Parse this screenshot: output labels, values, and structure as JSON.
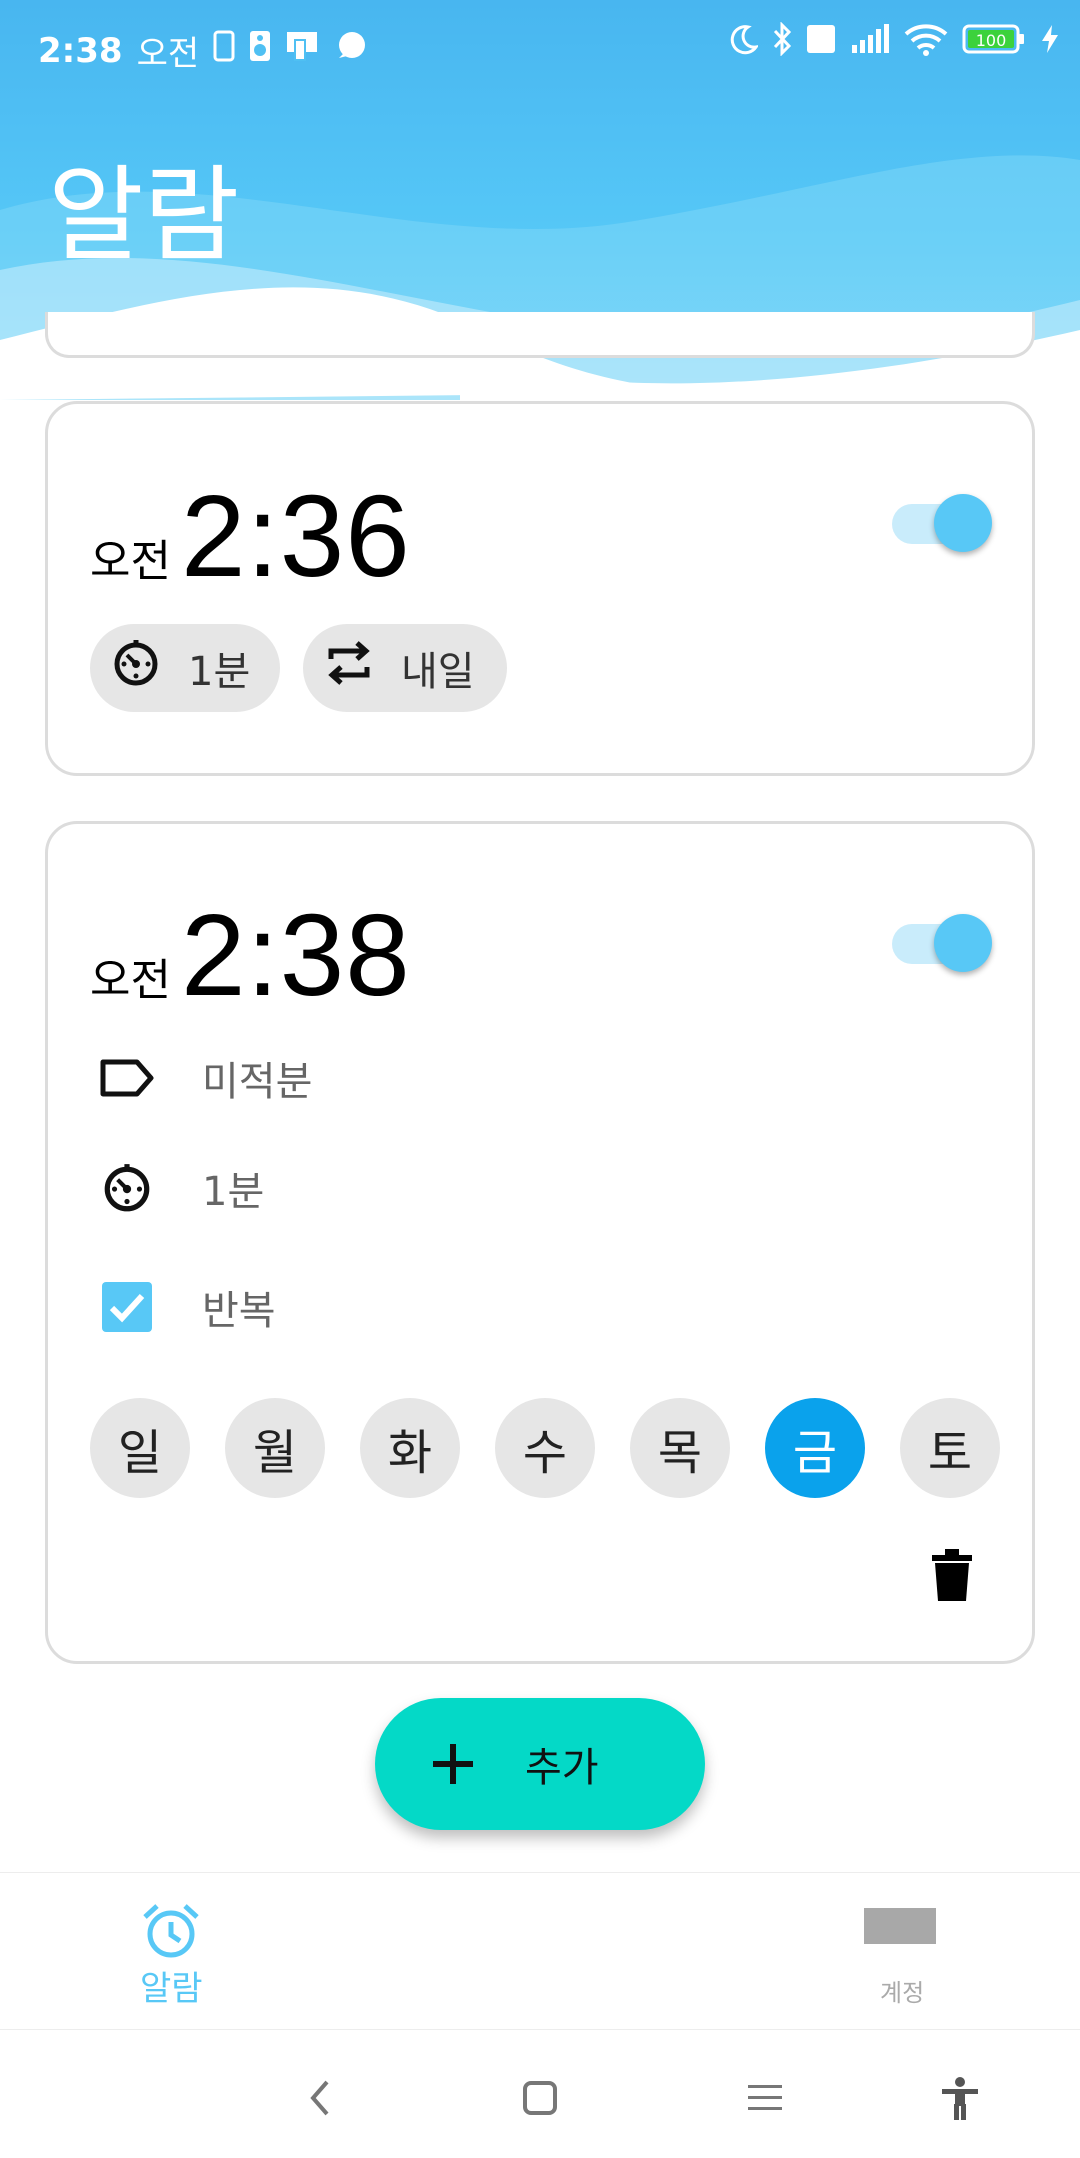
{
  "status_bar": {
    "time": "2:38",
    "ampm": "오전",
    "battery": "100"
  },
  "header": {
    "title": "알람"
  },
  "alarms": [
    {
      "ampm": "오전",
      "time": "2:36",
      "enabled": true,
      "chips": [
        {
          "icon": "timer-icon",
          "label": "1분"
        },
        {
          "icon": "repeat-icon",
          "label": "내일"
        }
      ]
    },
    {
      "ampm": "오전",
      "time": "2:38",
      "enabled": true,
      "label_text": "미적분",
      "snooze_text": "1분",
      "repeat_text": "반복",
      "repeat_checked": true,
      "days": [
        {
          "label": "일",
          "selected": false
        },
        {
          "label": "월",
          "selected": false
        },
        {
          "label": "화",
          "selected": false
        },
        {
          "label": "수",
          "selected": false
        },
        {
          "label": "목",
          "selected": false
        },
        {
          "label": "금",
          "selected": true
        },
        {
          "label": "토",
          "selected": false
        }
      ]
    }
  ],
  "fab": {
    "label": "추가"
  },
  "bottom_nav": {
    "alarm_label": "알람",
    "other_label": "계정"
  },
  "colors": {
    "accent": "#58c8f6",
    "day_selected": "#0aa2ec",
    "fab": "#04d9c7",
    "header": "#56c8f7"
  }
}
